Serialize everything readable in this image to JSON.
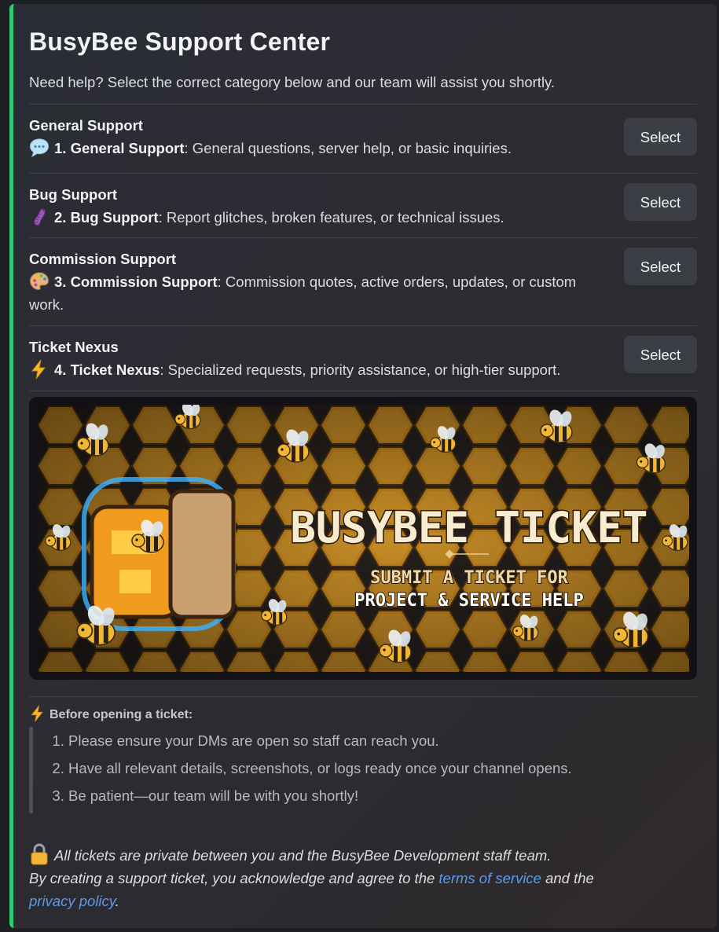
{
  "title": "BusyBee Support Center",
  "subtitle": "Need help? Select the correct category below and our team will assist you shortly.",
  "categories": [
    {
      "name": "General Support",
      "num": "1. General Support",
      "desc": ": General questions, server help, or basic inquiries.",
      "icon": "speech-bubble-icon",
      "button": "Select"
    },
    {
      "name": "Bug Support",
      "num": "2. Bug Support",
      "desc": ": Report glitches, broken features, or technical issues.",
      "icon": "bug-icon",
      "button": "Select"
    },
    {
      "name": "Commission Support",
      "num": "3. Commission Support",
      "desc": ": Commission quotes, active orders, updates, or custom work.",
      "icon": "palette-icon",
      "button": "Select"
    },
    {
      "name": "Ticket Nexus",
      "num": "4. Ticket Nexus",
      "desc": ": Specialized requests, priority assistance, or high-tier support.",
      "icon": "lightning-icon",
      "button": "Select"
    }
  ],
  "banner": {
    "headline": "BUSYBEE TICKET",
    "line1": "SUBMIT A TICKET FOR",
    "line2": "PROJECT & SERVICE HELP"
  },
  "before": {
    "title": "Before opening a ticket:",
    "items": [
      "Please ensure your DMs are open so staff can reach you.",
      "Have all relevant details, screenshots, or logs ready once your channel opens.",
      "Be patient—our team will be with you shortly!"
    ]
  },
  "footer": {
    "line1": "All tickets are private between you and the BusyBee Development staff team.",
    "line2_pre": "By creating a support ticket, you acknowledge and agree to the ",
    "tos_link": "terms of service",
    "line2_mid": " and the",
    "privacy_link": "privacy policy",
    "line3_end": "."
  },
  "colors": {
    "accent": "#2ecc71",
    "button": "#3c3e45",
    "link": "#5e9ae8",
    "honey": "#e89a1c"
  }
}
